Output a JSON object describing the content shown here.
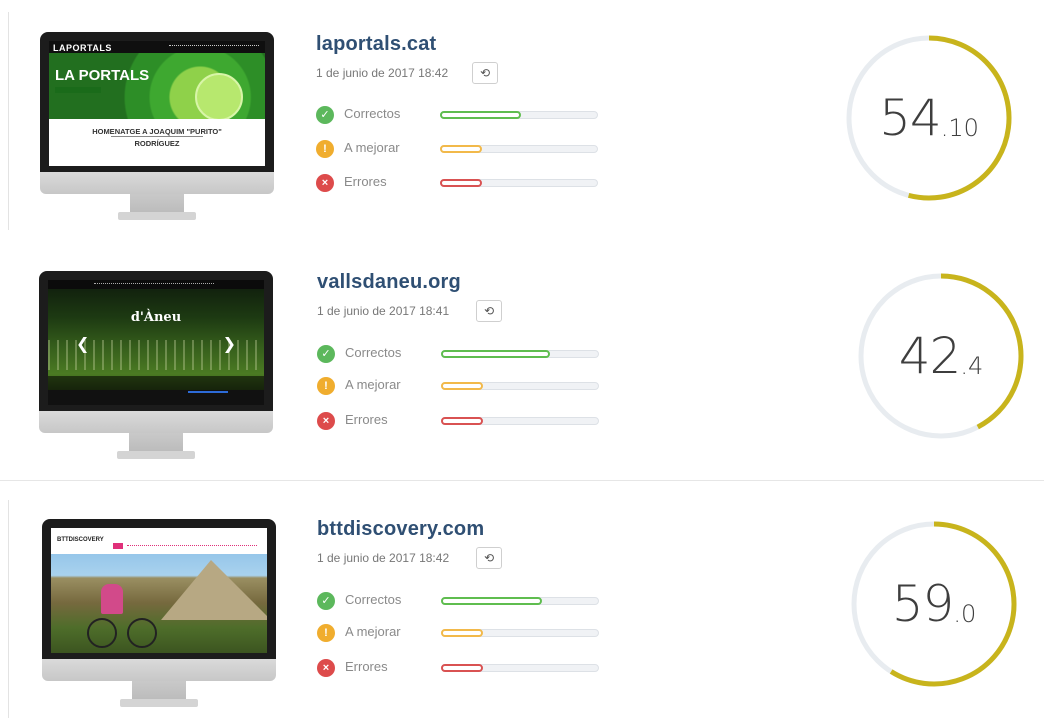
{
  "labels": {
    "correct": "Correctos",
    "improve": "A mejorar",
    "errors": "Errores"
  },
  "icons": {
    "correct": "check-circle-icon",
    "improve": "exclamation-circle-icon",
    "errors": "x-circle-icon",
    "refresh": "refresh-icon"
  },
  "colors": {
    "title": "#2f4f73",
    "correct": "#5fbd4f",
    "improve": "#f2b94a",
    "errors": "#d95252",
    "gauge_arc": "#c8b41c",
    "gauge_track": "#e8ecf0"
  },
  "sites": [
    {
      "name": "laportals.cat",
      "date": "1 de junio de 2017 18:42",
      "score_int": "54",
      "score_dec": ".10",
      "score": 54.1,
      "bars": {
        "correct": 0.52,
        "improve": 0.27,
        "errors": 0.27
      },
      "thumb": {
        "logo": "LAPORTALS",
        "hero": "LA PORTALS",
        "headline1": "HOMENATGE A JOAQUIM \"PURITO\"",
        "headline2": "RODRÍGUEZ"
      }
    },
    {
      "name": "vallsdaneu.org",
      "date": "1 de junio de 2017 18:41",
      "score_int": "42",
      "score_dec": ".4",
      "score": 42.4,
      "bars": {
        "correct": 0.7,
        "improve": 0.27,
        "errors": 0.27
      },
      "thumb": {
        "title": "d'Àneu"
      }
    },
    {
      "name": "bttdiscovery.com",
      "date": "1 de junio de 2017 18:42",
      "score_int": "59",
      "score_dec": ".0",
      "score": 59.0,
      "bars": {
        "correct": 0.65,
        "improve": 0.27,
        "errors": 0.27
      },
      "thumb": {
        "brand": "BTTDISCOVERY"
      }
    }
  ]
}
